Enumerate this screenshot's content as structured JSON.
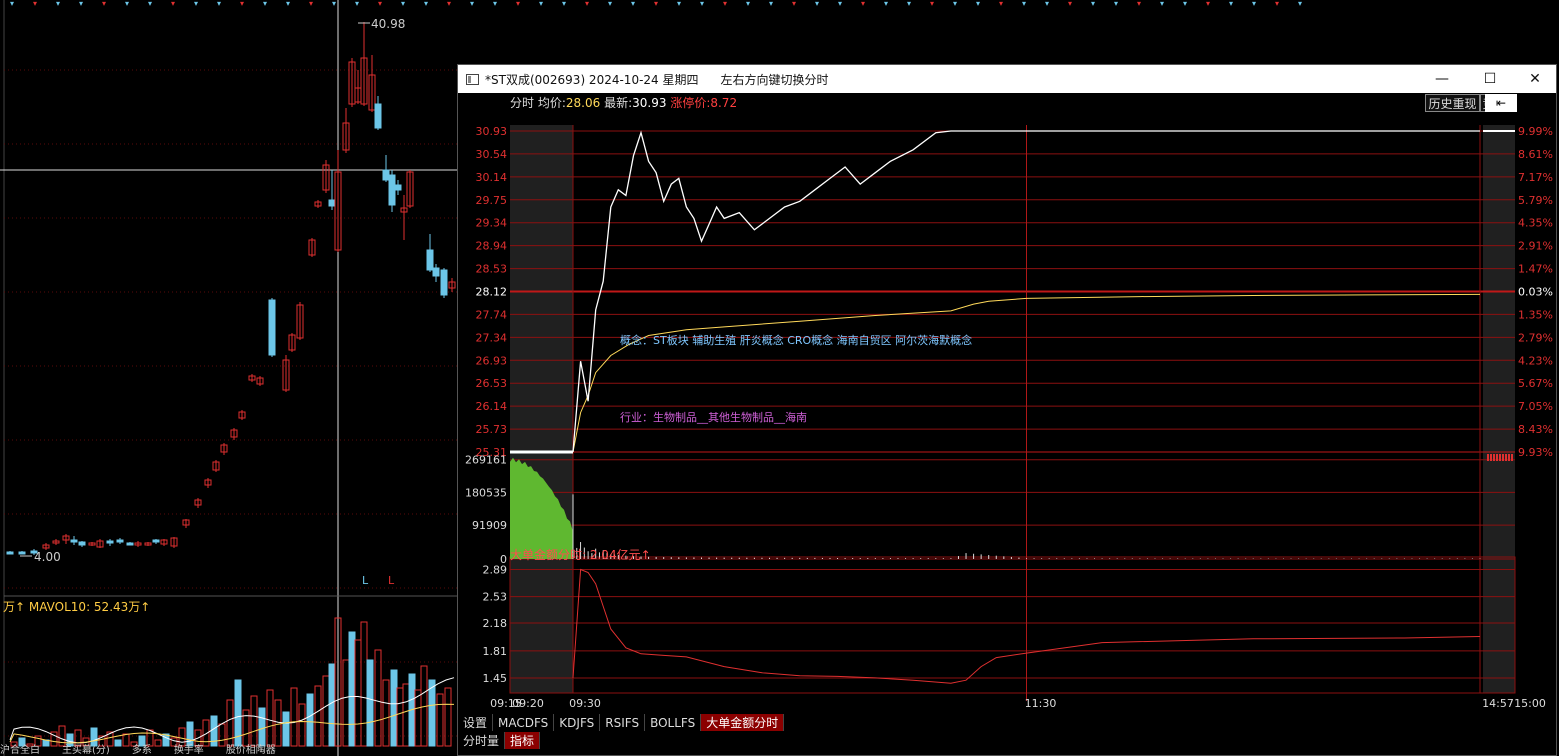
{
  "background": {
    "volume_label": "万↑ MAVOL10: 52.43万↑",
    "peak_price": "40.98",
    "low_price": "4.00",
    "candle_tags": [
      "L",
      "L"
    ],
    "bottom_labels": [
      "沪合全白",
      "主买幕(分)",
      "多系",
      "换手率",
      "股价相陶器"
    ]
  },
  "window": {
    "title": "*ST双成(002693) 2024-10-24 星期四",
    "hint": "左右方向键切换分时",
    "min_icon": "—",
    "max_icon": "☐",
    "close_icon": "✕",
    "history_button": "历史重现",
    "bid_button": "竞",
    "back_icon": "⇤"
  },
  "info_bar": {
    "label": "分时",
    "avg_label": "均价:",
    "avg": "28.06",
    "last_label": "最新:",
    "last": "30.93",
    "limit_label": "涨停价:",
    "limit": "8.72"
  },
  "chart_data": {
    "type": "line",
    "prev_close": 28.12,
    "price_ticks_left": [
      "30.93",
      "30.54",
      "30.14",
      "29.75",
      "29.34",
      "28.94",
      "28.53",
      "28.12",
      "27.74",
      "27.34",
      "26.93",
      "26.53",
      "26.14",
      "25.73",
      "25.31"
    ],
    "price_ticks_right": [
      "9.99%",
      "8.61%",
      "7.17%",
      "5.79%",
      "4.35%",
      "2.91%",
      "1.47%",
      "0.03%",
      "1.35%",
      "2.79%",
      "4.23%",
      "5.67%",
      "7.05%",
      "8.43%",
      "9.93%"
    ],
    "volume_ticks": [
      "269161",
      "180535",
      "91909",
      "0"
    ],
    "indicator_title": "大单金额分时: 2.04亿元↑",
    "indicator_ticks": [
      "2.89",
      "2.53",
      "2.18",
      "1.81",
      "1.45"
    ],
    "time_labels": [
      "09:15",
      "09:20",
      "09:30",
      "11:30",
      "14:57",
      "15:00"
    ],
    "price_series": {
      "name": "价格",
      "minutes": [
        0,
        2,
        4,
        6,
        8,
        10,
        12,
        14,
        16,
        18,
        20,
        22,
        24,
        26,
        28,
        30,
        32,
        34,
        36,
        38,
        40,
        44,
        48,
        52,
        56,
        60,
        64,
        68,
        72,
        76,
        80,
        84,
        90,
        96,
        100,
        106,
        110,
        120,
        150,
        180,
        210,
        240
      ],
      "values": [
        25.31,
        26.9,
        26.2,
        27.8,
        28.3,
        29.6,
        29.9,
        29.8,
        30.5,
        30.9,
        30.4,
        30.2,
        29.7,
        30.0,
        30.1,
        29.6,
        29.4,
        29.0,
        29.3,
        29.6,
        29.4,
        29.5,
        29.2,
        29.4,
        29.6,
        29.7,
        29.9,
        30.1,
        30.3,
        30.0,
        30.2,
        30.4,
        30.6,
        30.9,
        30.93,
        30.93,
        30.93,
        30.93,
        30.93,
        30.93,
        30.93,
        30.93
      ]
    },
    "avg_series": {
      "name": "均价",
      "minutes": [
        0,
        2,
        4,
        6,
        10,
        15,
        20,
        30,
        40,
        60,
        80,
        100,
        106,
        110,
        120,
        150,
        180,
        210,
        240
      ],
      "values": [
        25.31,
        26.0,
        26.3,
        26.7,
        27.0,
        27.2,
        27.35,
        27.45,
        27.5,
        27.6,
        27.7,
        27.78,
        27.9,
        27.95,
        28.0,
        28.03,
        28.05,
        28.06,
        28.07
      ]
    },
    "indicator_series": {
      "name": "大单金额",
      "minutes": [
        0,
        2,
        4,
        6,
        8,
        10,
        14,
        18,
        24,
        30,
        40,
        50,
        60,
        70,
        80,
        90,
        100,
        104,
        108,
        112,
        120,
        140,
        180,
        220,
        240
      ],
      "values": [
        1.45,
        2.89,
        2.85,
        2.7,
        2.4,
        2.1,
        1.85,
        1.77,
        1.75,
        1.73,
        1.6,
        1.52,
        1.48,
        1.47,
        1.45,
        1.42,
        1.38,
        1.42,
        1.6,
        1.72,
        1.78,
        1.92,
        1.97,
        1.98,
        2.0
      ]
    },
    "volume_series": {
      "name": "成交量",
      "minutes": [
        0,
        1,
        2,
        3,
        4,
        5,
        6,
        7,
        8,
        9,
        10,
        12,
        14,
        16,
        20,
        25,
        30,
        40,
        60,
        80,
        100,
        102,
        104,
        120,
        150,
        200,
        240
      ],
      "values": [
        175000,
        30000,
        46000,
        31000,
        21000,
        16000,
        28000,
        18000,
        24000,
        16000,
        13000,
        11000,
        9000,
        7500,
        6000,
        5000,
        4200,
        3500,
        3000,
        2500,
        2200,
        8000,
        16000,
        2000,
        1500,
        1200,
        1500
      ]
    },
    "auction_volume": 269161
  },
  "annotations": {
    "concept": "概念：ST板块  辅助生殖  肝炎概念  CRO概念  海南自贸区  阿尔茨海默概念",
    "industry": "行业：生物制品__其他生物制品__海南"
  },
  "tabs": [
    "设置",
    "MACDFS",
    "KDJFS",
    "RSIFS",
    "BOLLFS",
    "大单金额分时"
  ],
  "tabs_active": "大单金额分时",
  "tabs2": [
    "分时量",
    "指标"
  ],
  "tabs2_active": "指标",
  "colors": {
    "up": "#e03030",
    "flat": "#6cc6e8",
    "price_line": "#ffffff",
    "avg_line": "#ffd95a",
    "grid": "#8b1010",
    "volume_green": "#5fb830",
    "indicator": "#e03030"
  }
}
